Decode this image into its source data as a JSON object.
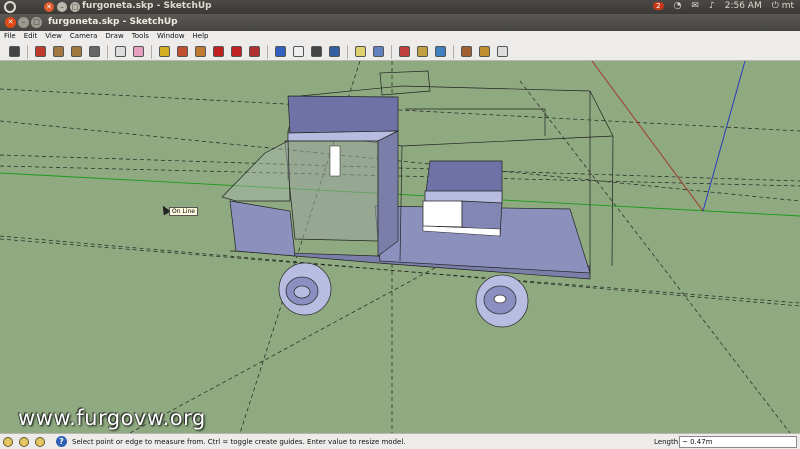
{
  "panel": {
    "title": "furgoneta.skp - SketchUp",
    "badge": "2",
    "time": "2:56 AM",
    "user": "mt"
  },
  "window": {
    "title": "furgoneta.skp - SketchUp"
  },
  "menu": [
    "File",
    "Edit",
    "View",
    "Camera",
    "Draw",
    "Tools",
    "Window",
    "Help"
  ],
  "toolbar": [
    {
      "name": "select-tool-icon",
      "color": "#444"
    },
    {
      "name": "line-tool-icon",
      "color": "#c0392b"
    },
    {
      "name": "rectangle-tool-icon",
      "color": "#a07840"
    },
    {
      "name": "circle-tool-icon",
      "color": "#a07840"
    },
    {
      "name": "arc-tool-icon",
      "color": "#666"
    },
    {
      "name": "make-component-icon",
      "color": "#ddd"
    },
    {
      "name": "eraser-tool-icon",
      "color": "#e8a0c0"
    },
    {
      "name": "tape-measure-tool-icon",
      "color": "#d4b020"
    },
    {
      "name": "paint-bucket-tool-icon",
      "color": "#c05030"
    },
    {
      "name": "push-pull-tool-icon",
      "color": "#c07a30"
    },
    {
      "name": "move-tool-icon",
      "color": "#c02020"
    },
    {
      "name": "rotate-tool-icon",
      "color": "#c02020"
    },
    {
      "name": "offset-tool-icon",
      "color": "#b03030"
    },
    {
      "name": "orbit-tool-icon",
      "color": "#3060c0"
    },
    {
      "name": "pan-tool-icon",
      "color": "#eee"
    },
    {
      "name": "zoom-tool-icon",
      "color": "#444"
    },
    {
      "name": "zoom-extents-icon",
      "color": "#3060a0"
    },
    {
      "name": "add-location-icon",
      "color": "#e0d070"
    },
    {
      "name": "toggle-terrain-icon",
      "color": "#6080c0"
    },
    {
      "name": "get-models-icon",
      "color": "#c04040"
    },
    {
      "name": "share-model-icon",
      "color": "#c0a040"
    },
    {
      "name": "google-earth-icon",
      "color": "#4080c0"
    },
    {
      "name": "component-window-icon",
      "color": "#a06030"
    },
    {
      "name": "get-photo-texture-icon",
      "color": "#c09030"
    },
    {
      "name": "send-to-layout-icon",
      "color": "#ddd"
    }
  ],
  "viewport": {
    "tooltip": "On Line",
    "watermark": "www.furgovw.org"
  },
  "status": {
    "message": "Select point or edge to measure from.  Ctrl = toggle create guides.  Enter value to resize model.",
    "length_label": "Length",
    "length_value": "~ 0.47m"
  }
}
